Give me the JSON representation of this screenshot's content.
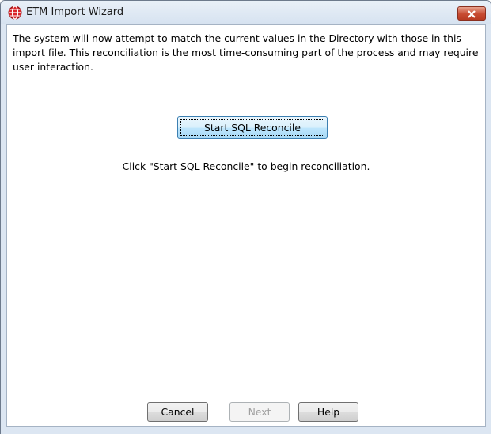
{
  "window": {
    "title": "ETM Import Wizard",
    "icon": "globe-icon",
    "close_icon": "close-icon"
  },
  "content": {
    "description": "The system will now attempt to match the current values in the Directory with those in this import file.  This reconciliation is the most time-consuming part of the process and may require user interaction.",
    "start_button_label": "Start SQL Reconcile",
    "instruction": "Click \"Start SQL Reconcile\" to begin reconciliation."
  },
  "footer": {
    "cancel_label": "Cancel",
    "next_label": "Next",
    "next_enabled": false,
    "help_label": "Help"
  },
  "colors": {
    "title_bar": "#dce6f2",
    "close_button": "#c74b32",
    "primary_button": "#bee6fd"
  }
}
